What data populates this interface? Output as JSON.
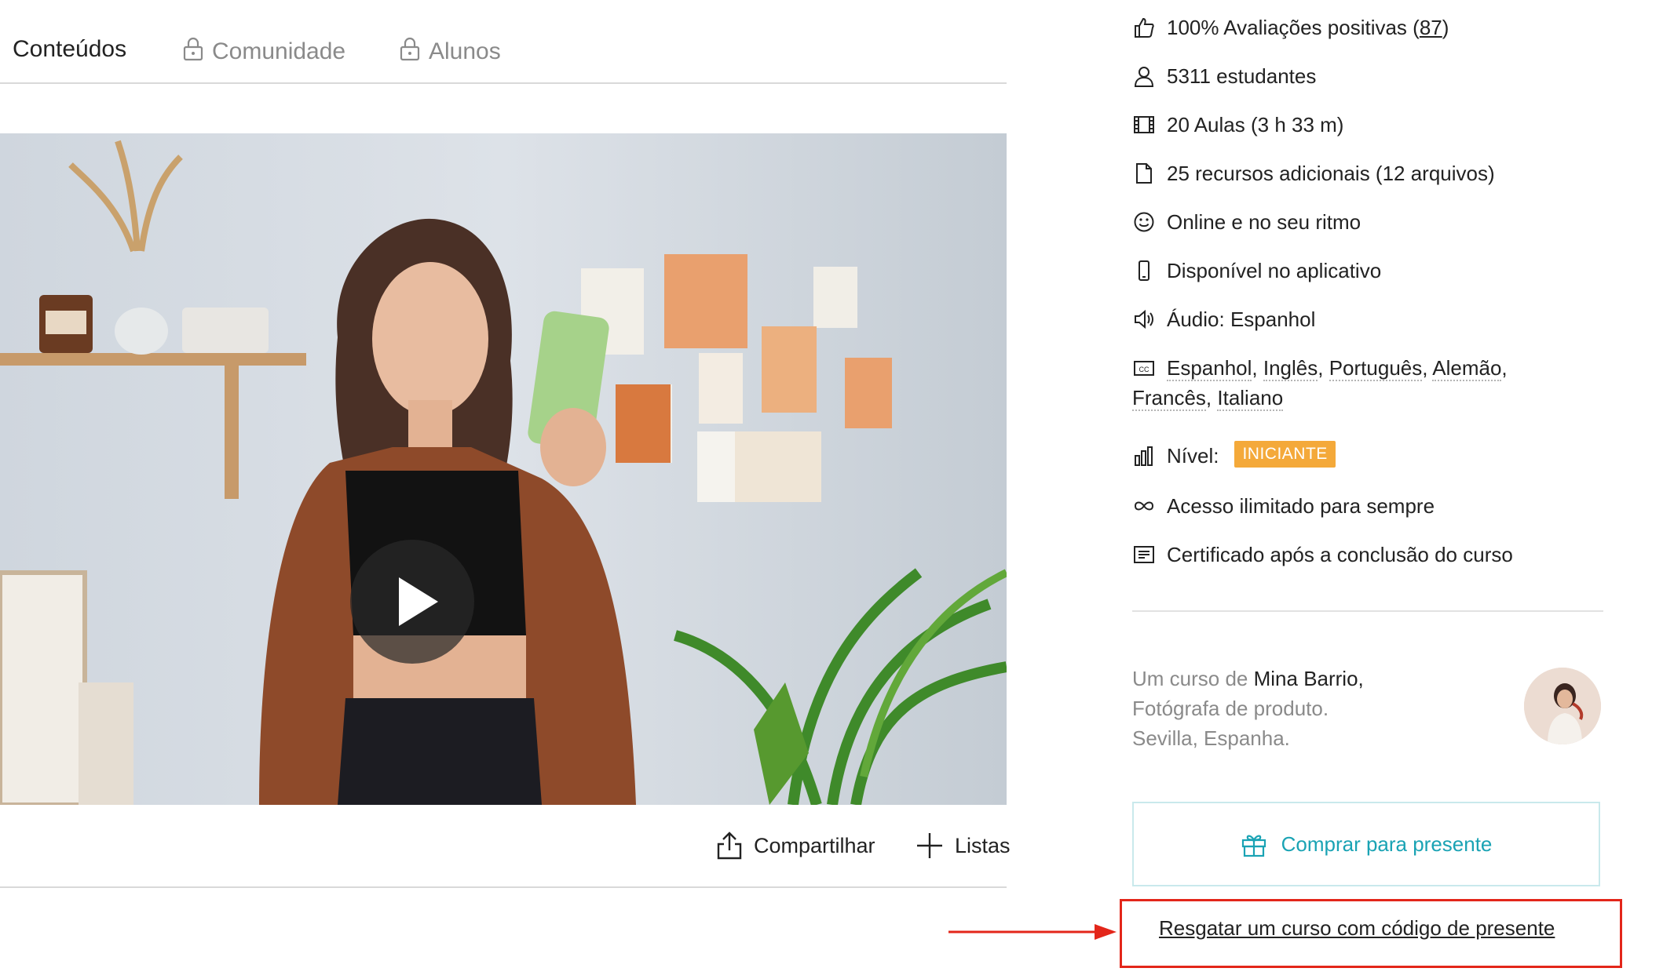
{
  "tabs": [
    {
      "label": "Conteúdos",
      "locked": false
    },
    {
      "label": "Comunidade",
      "locked": true
    },
    {
      "label": "Alunos",
      "locked": true
    }
  ],
  "video": {
    "play_icon": "play-icon"
  },
  "actions": {
    "share_label": "Compartilhar",
    "lists_label": "Listas"
  },
  "features": {
    "reviews_prefix": "100% Avaliações positivas (",
    "reviews_count": "87",
    "reviews_suffix": ")",
    "students": "5311 estudantes",
    "lessons": "20 Aulas (3 h 33 m)",
    "resources": "25 recursos adicionais (12 arquivos)",
    "online": "Online e no seu ritmo",
    "app": "Disponível no aplicativo",
    "audio": "Áudio: Espanhol",
    "subtitles": [
      "Espanhol",
      "Inglês",
      "Português",
      "Alemão",
      "Francês",
      "Italiano"
    ],
    "level_label": "Nível:",
    "level_badge": "INICIANTE",
    "access": "Acesso ilimitado para sempre",
    "certificate": "Certificado após a conclusão do curso"
  },
  "author": {
    "prefix": "Um curso de ",
    "name": "Mina Barrio,",
    "role": "Fotógrafa de produto.",
    "location": "Sevilla, Espanha."
  },
  "gift_button": "Comprar para presente",
  "redeem_link": "Resgatar um curso com código de presente",
  "colors": {
    "accent": "#1aa3b4",
    "badge": "#f4a93a",
    "highlight": "#e3261a"
  }
}
